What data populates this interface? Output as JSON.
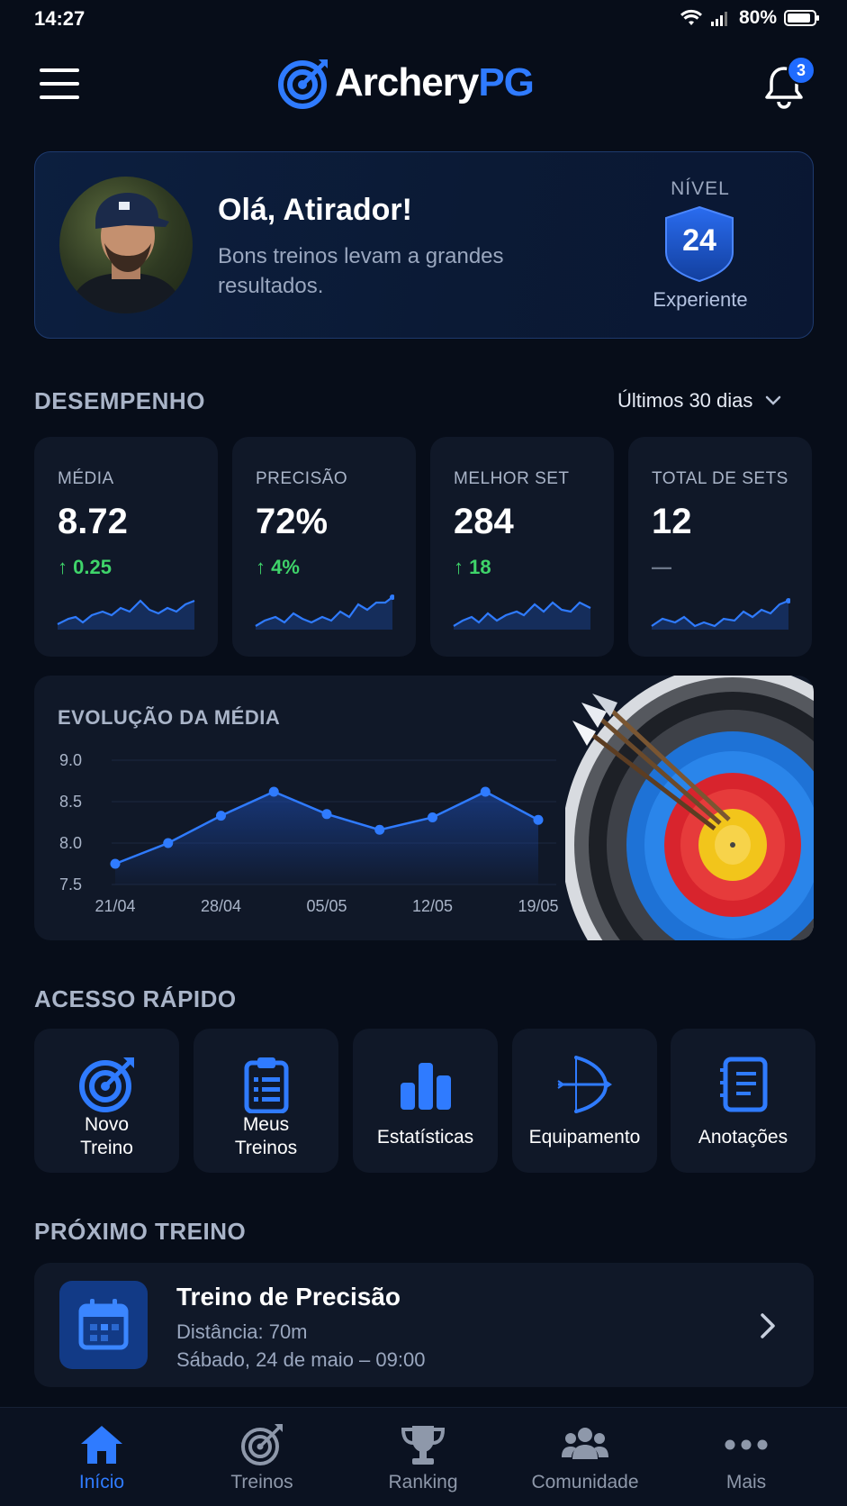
{
  "status_bar": {
    "time": "14:27",
    "battery": "80%"
  },
  "header": {
    "logo_part1": "Archery",
    "logo_part2": "PG",
    "notification_count": "3"
  },
  "profile": {
    "greeting": "Olá, Atirador!",
    "subtitle": "Bons treinos levam a grandes resultados.",
    "level_label": "NÍVEL",
    "level": "24",
    "rank": "Experiente"
  },
  "performance": {
    "title": "DESEMPENHO",
    "period": "Últimos 30 dias",
    "stats": [
      {
        "label": "MÉDIA",
        "value": "8.72",
        "delta": "↑ 0.25"
      },
      {
        "label": "PRECISÃO",
        "value": "72%",
        "delta": "↑ 4%"
      },
      {
        "label": "MELHOR SET",
        "value": "284",
        "delta": "↑ 18"
      },
      {
        "label": "TOTAL DE SETS",
        "value": "12",
        "delta": "—"
      }
    ]
  },
  "evolution": {
    "title": "EVOLUÇÃO DA MÉDIA"
  },
  "chart_data": {
    "type": "area",
    "title": "EVOLUÇÃO DA MÉDIA",
    "x_tick_labels": [
      "21/04",
      "28/04",
      "05/05",
      "12/05",
      "19/05"
    ],
    "y_tick_labels": [
      "9.0",
      "8.5",
      "8.0",
      "7.5"
    ],
    "ylim": [
      7.5,
      9.0
    ],
    "values": [
      7.75,
      8.0,
      8.33,
      8.62,
      8.35,
      8.16,
      8.31,
      8.62,
      8.28
    ],
    "grid": true
  },
  "quick_access": {
    "title": "ACESSO RÁPIDO",
    "items": [
      {
        "label_line1": "Novo",
        "label_line2": "Treino",
        "icon": "target-icon"
      },
      {
        "label_line1": "Meus",
        "label_line2": "Treinos",
        "icon": "clipboard-icon"
      },
      {
        "label_line1": "Estatísticas",
        "label_line2": "",
        "icon": "bar-chart-icon"
      },
      {
        "label_line1": "Equipamento",
        "label_line2": "",
        "icon": "bow-icon"
      },
      {
        "label_line1": "Anotações",
        "label_line2": "",
        "icon": "notebook-icon"
      }
    ]
  },
  "next_training": {
    "section_title": "PRÓXIMO TREINO",
    "title": "Treino de Precisão",
    "distance": "Distância: 70m",
    "datetime": "Sábado, 24 de maio – 09:00"
  },
  "bottom_nav": {
    "items": [
      {
        "label": "Início",
        "icon": "home-icon",
        "active": true
      },
      {
        "label": "Treinos",
        "icon": "target-icon",
        "active": false
      },
      {
        "label": "Ranking",
        "icon": "trophy-icon",
        "active": false
      },
      {
        "label": "Comunidade",
        "icon": "people-icon",
        "active": false
      },
      {
        "label": "Mais",
        "icon": "more-icon",
        "active": false
      }
    ]
  },
  "colors": {
    "accent": "#2f7bff",
    "positive": "#3fd46a",
    "card": "#101828",
    "background": "#070d19"
  }
}
